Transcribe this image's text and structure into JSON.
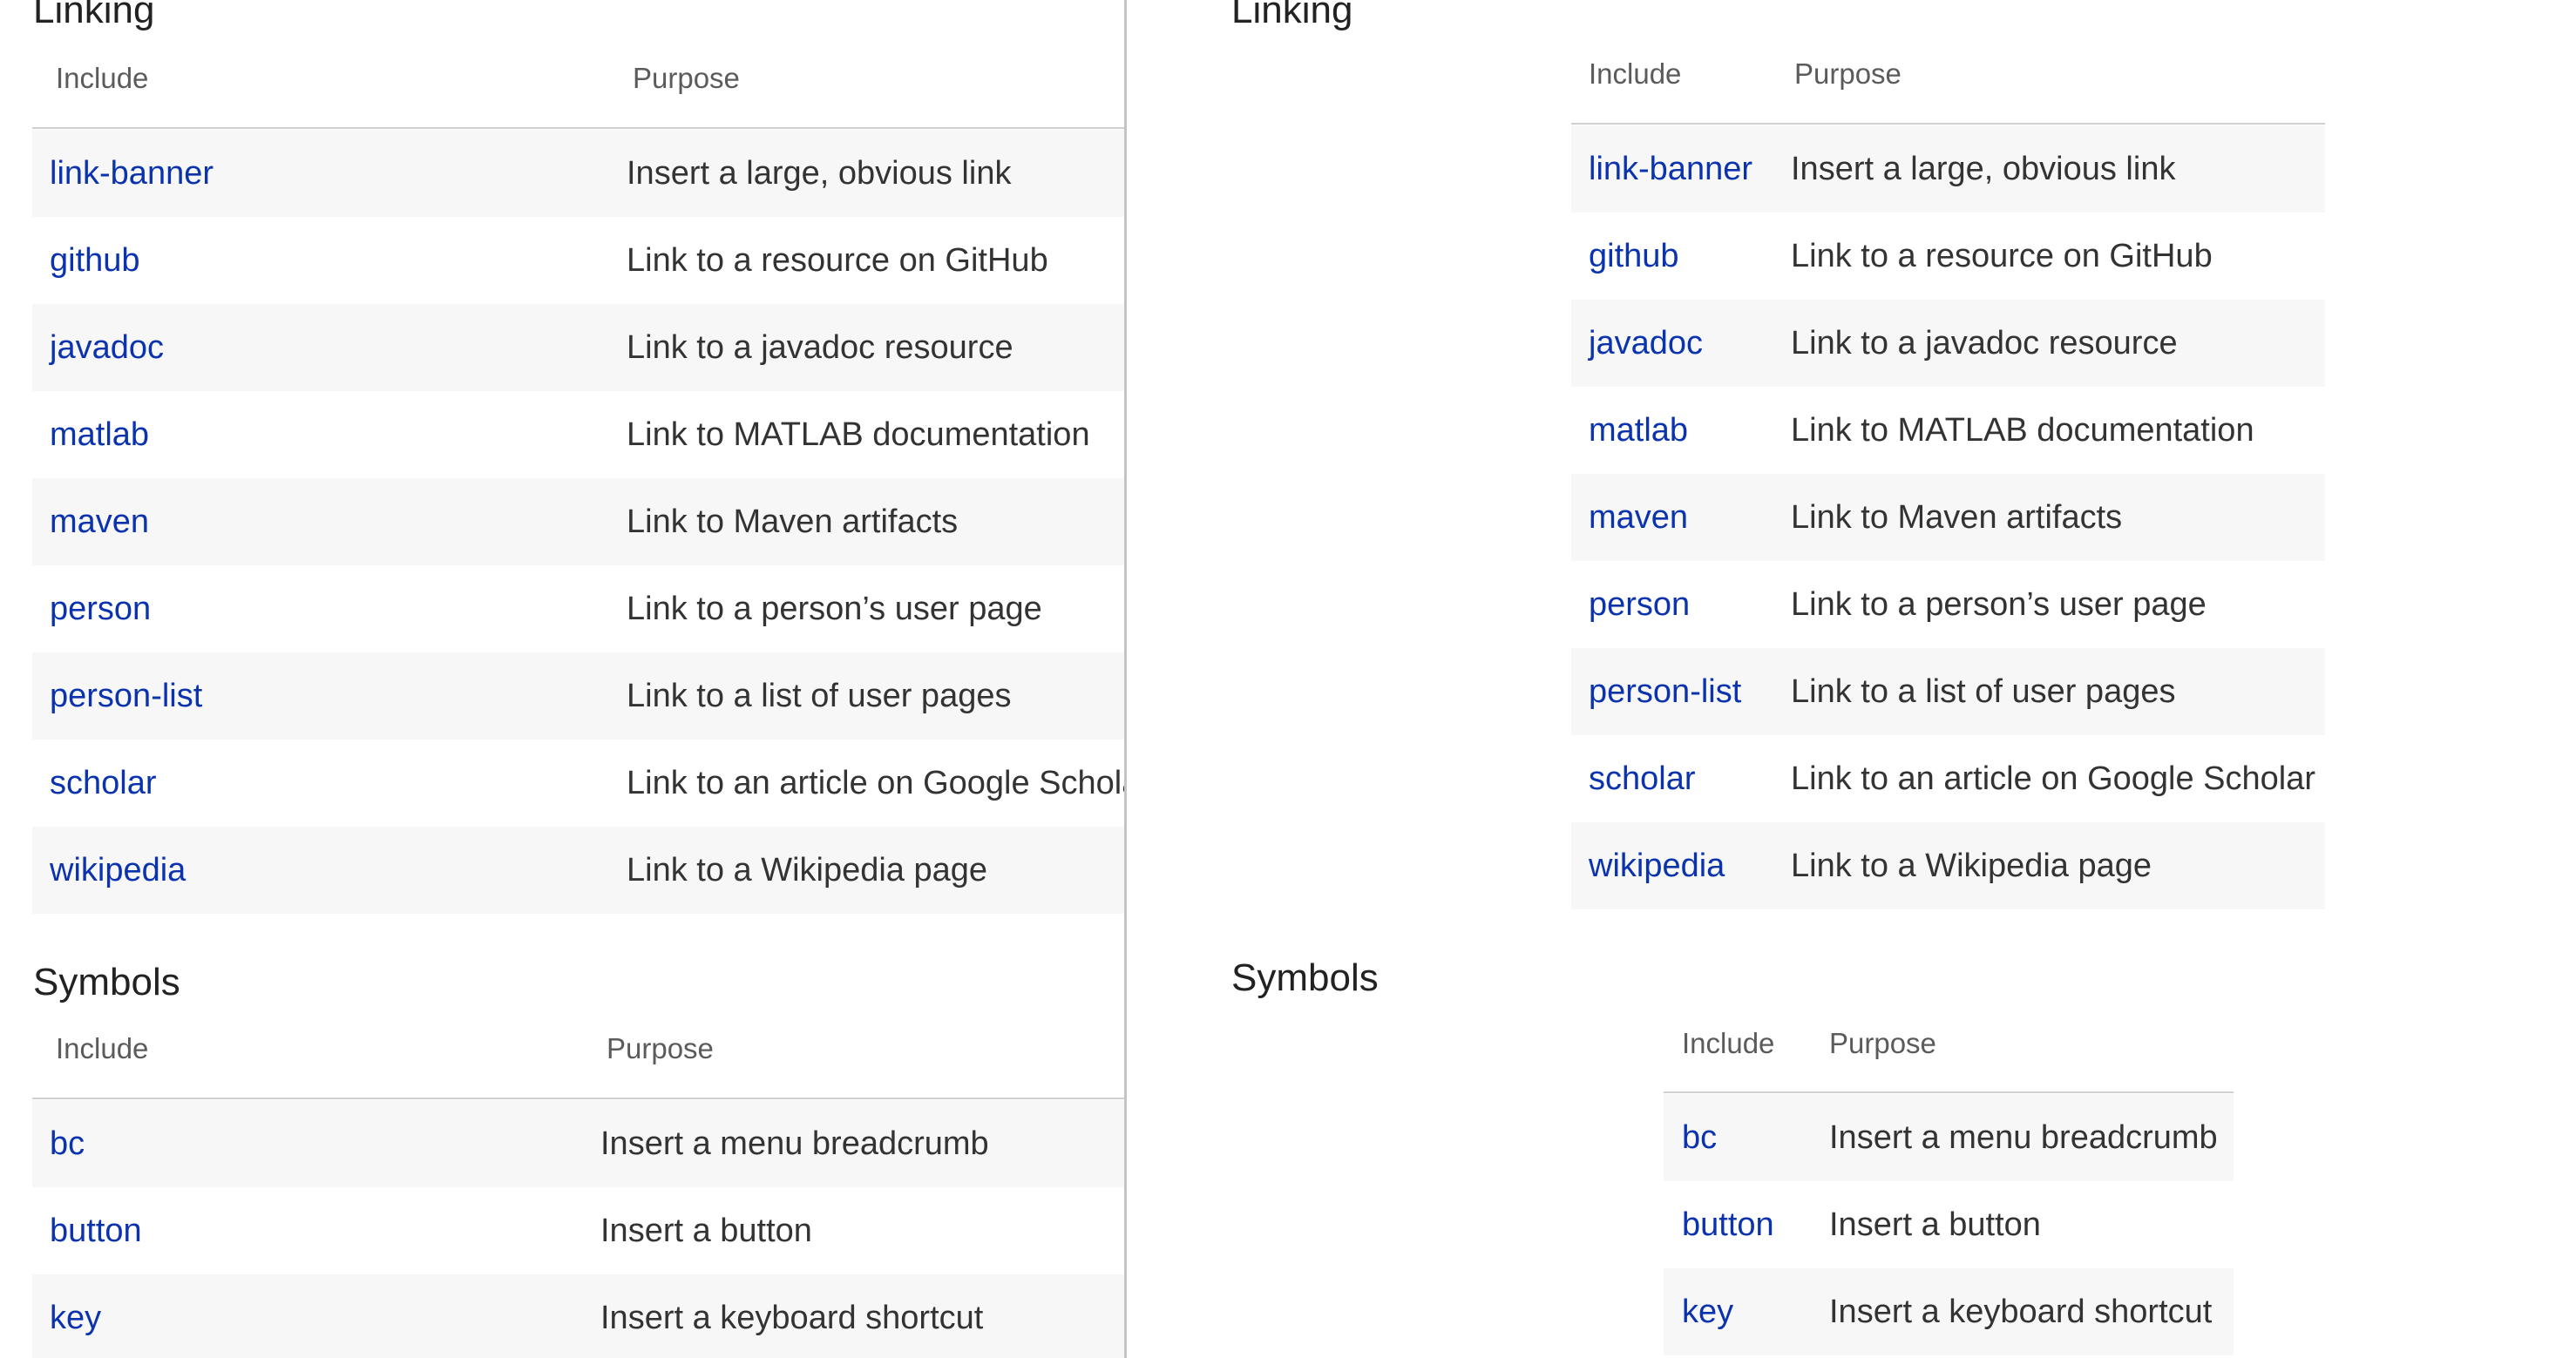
{
  "colors": {
    "link": "#0b33ad",
    "text": "#333333",
    "header_text": "#5b5b5b",
    "row_alt": "#f7f7f7",
    "divider": "#c4c4c4",
    "rule": "#d0d0d0"
  },
  "left_pane": {
    "linking": {
      "heading": "Linking",
      "columns": {
        "include": "Include",
        "purpose": "Purpose"
      },
      "rows": [
        {
          "include": "link-banner",
          "purpose": "Insert a large, obvious link"
        },
        {
          "include": "github",
          "purpose": "Link to a resource on GitHub"
        },
        {
          "include": "javadoc",
          "purpose": "Link to a javadoc resource"
        },
        {
          "include": "matlab",
          "purpose": "Link to MATLAB documentation"
        },
        {
          "include": "maven",
          "purpose": "Link to Maven artifacts"
        },
        {
          "include": "person",
          "purpose": "Link to a person’s user page"
        },
        {
          "include": "person-list",
          "purpose": "Link to a list of user pages"
        },
        {
          "include": "scholar",
          "purpose": "Link to an article on Google Scholar"
        },
        {
          "include": "wikipedia",
          "purpose": "Link to a Wikipedia page"
        }
      ]
    },
    "symbols": {
      "heading": "Symbols",
      "columns": {
        "include": "Include",
        "purpose": "Purpose"
      },
      "rows": [
        {
          "include": "bc",
          "purpose": "Insert a menu breadcrumb"
        },
        {
          "include": "button",
          "purpose": "Insert a button"
        },
        {
          "include": "key",
          "purpose": "Insert a keyboard shortcut"
        }
      ]
    }
  },
  "right_pane": {
    "linking": {
      "heading": "Linking",
      "columns": {
        "include": "Include",
        "purpose": "Purpose"
      },
      "rows": [
        {
          "include": "link-banner",
          "purpose": "Insert a large, obvious link"
        },
        {
          "include": "github",
          "purpose": "Link to a resource on GitHub"
        },
        {
          "include": "javadoc",
          "purpose": "Link to a javadoc resource"
        },
        {
          "include": "matlab",
          "purpose": "Link to MATLAB documentation"
        },
        {
          "include": "maven",
          "purpose": "Link to Maven artifacts"
        },
        {
          "include": "person",
          "purpose": "Link to a person’s user page"
        },
        {
          "include": "person-list",
          "purpose": "Link to a list of user pages"
        },
        {
          "include": "scholar",
          "purpose": "Link to an article on Google Scholar"
        },
        {
          "include": "wikipedia",
          "purpose": "Link to a Wikipedia page"
        }
      ]
    },
    "symbols": {
      "heading": "Symbols",
      "columns": {
        "include": "Include",
        "purpose": "Purpose"
      },
      "rows": [
        {
          "include": "bc",
          "purpose": "Insert a menu breadcrumb"
        },
        {
          "include": "button",
          "purpose": "Insert a button"
        },
        {
          "include": "key",
          "purpose": "Insert a keyboard shortcut"
        }
      ]
    }
  }
}
